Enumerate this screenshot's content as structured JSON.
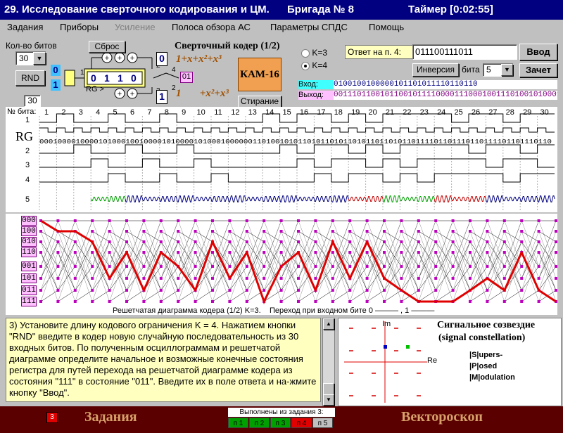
{
  "title": {
    "app": "29. Исследование сверточного кодирования и ЦМ.",
    "brigade": "Бригада № 8",
    "timer": "Таймер [0:02:55]"
  },
  "menu": [
    "Задания",
    "Приборы",
    "Усиление",
    "Полоса обзора АС",
    "Параметры СПДС",
    "Помощь"
  ],
  "controls": {
    "bits_count_label": "Кол-во битов",
    "bits_count_value": "30",
    "rnd": "RND",
    "reset": "Сброс",
    "erase": "Стирание",
    "counter": "30",
    "input_bits": [
      "0",
      "1"
    ],
    "enter": "Ввод",
    "inversion": "Инверсия",
    "bit_label": "бита",
    "bit_value": "5",
    "credit": "Зачет"
  },
  "encoder": {
    "title": "Сверточный кодер (1/2)",
    "register": [
      "0",
      "1",
      "1",
      "0"
    ],
    "poly1": "1+x+x²+x³",
    "poly2": "1       +x²+x³",
    "rg_label": "RG >",
    "mod": "КАМ-16",
    "out_top": "0",
    "out_bot": "1",
    "pair": "01",
    "k_options": [
      "K=3",
      "K=4"
    ],
    "k_selected": "K=4",
    "port_labels": [
      "0",
      "1",
      "2",
      "4",
      "3",
      "5",
      "1",
      "2",
      "3"
    ]
  },
  "answer": {
    "label": "Ответ на п. 4:",
    "value": "011100111011"
  },
  "io": {
    "in_label": "Вход:",
    "in_value": "0100100100000101101011110110110",
    "out_label": "Выход:",
    "out_value": "00111011001011001011110000111000100111010010100011011"
  },
  "timing": {
    "bit_no_label": "№ бита:",
    "bit_numbers": [
      "1",
      "2",
      "3",
      "4",
      "5",
      "6",
      "7",
      "8",
      "9",
      "10",
      "11",
      "12",
      "13",
      "14",
      "15",
      "16",
      "17",
      "18",
      "19",
      "20",
      "21",
      "22",
      "23",
      "24",
      "25",
      "26",
      "27",
      "28",
      "29",
      "30"
    ],
    "row_labels": [
      "1",
      "2",
      "3",
      "4",
      "5"
    ],
    "rg_label": "RG",
    "rg_string": "00010000100001010001001000010100001010001000000110100101011010110101101011011010110111101101110110111101101110110"
  },
  "trellis": {
    "states": [
      "000",
      "100",
      "010",
      "110",
      "001",
      "101",
      "011",
      "111"
    ],
    "caption": "Решетчатая диаграмма кодера (1/2) K=3.    Переход при входном бите 0 ——— , 1 ———",
    "path": [
      1,
      1,
      2,
      5,
      3,
      6,
      3,
      4,
      6,
      2,
      5,
      3,
      7,
      4,
      3,
      6,
      2,
      5,
      2,
      5,
      6,
      7,
      7,
      7,
      6,
      5,
      6,
      3,
      6,
      7
    ]
  },
  "task": {
    "text": "3) Установите длину кодового ограничения K = 4. Нажатием кнопки \"RND\" введите в кодер новую случайную последовательность из 30 входных битов. По полученным осциллограммам и решетчатой диаграмме определите начальное и возможные конечные состояния регистра для путей перехода на решетчатой диаграмме кодера из состояния \"111\" в состояние \"011\". Введите их в поле ответа и на-жмите кнопку \"Ввод\"."
  },
  "vectorscope": {
    "title": "Сигнальное созвездие",
    "subtitle": "(signal constellation)",
    "im": "Im",
    "re": "Re",
    "spm": [
      "|S|upers-",
      "|P|osed",
      "|M|odulation"
    ]
  },
  "bottom": {
    "tasks_label": "Задания",
    "task_num": "3",
    "vectorscope_label": "Векторoскоп",
    "done_label": "Выполнены из задания 3:",
    "items": [
      {
        "label": "п 1",
        "color": "#00a000"
      },
      {
        "label": "п 2",
        "color": "#00a000"
      },
      {
        "label": "п 3",
        "color": "#00a000"
      },
      {
        "label": "п 4",
        "color": "#e00000"
      },
      {
        "label": "п 5",
        "color": "#c0c0c0"
      }
    ]
  },
  "colors": {
    "title_bg": "#000080",
    "trellis_path": "#e00000",
    "state_bg": "#ffc0ff",
    "bottom_bg": "#5a0000"
  }
}
